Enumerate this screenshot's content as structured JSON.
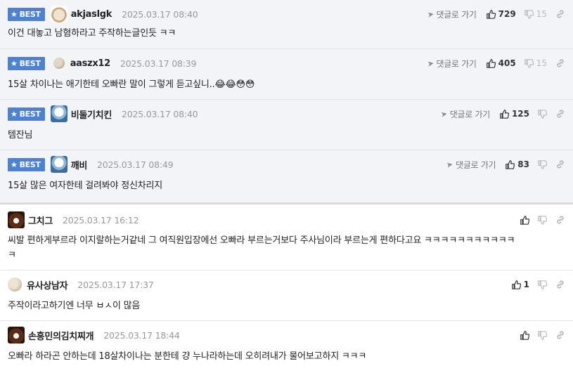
{
  "labels": {
    "best": "BEST",
    "reply": "댓글로 가기"
  },
  "colors": {
    "best_badge": "#4b82d6",
    "best_row_bg": "#f2f4f7"
  },
  "comments": [
    {
      "best": true,
      "avatar": "dog-avatar",
      "nick": "akjaslgk",
      "date": "2025.03.17 08:40",
      "text": "이건 대놓고 남혐하라고 주작하는글인듯 ㅋㅋ",
      "up": "729",
      "down": "15",
      "has_reply": true
    },
    {
      "best": true,
      "avatar": "ball-avatar",
      "nick": "aaszx12",
      "date": "2025.03.17 08:39",
      "text": "15살 차이나는 애기한테 오빠란 말이 그렇게 듣고싶니..😂😂😳😳",
      "up": "405",
      "down": "15",
      "has_reply": true
    },
    {
      "best": true,
      "avatar": "bird-avatar",
      "nick": "비둘기치킨",
      "date": "2025.03.17 08:40",
      "text": "템잔님",
      "up": "125",
      "down": "",
      "has_reply": true
    },
    {
      "best": true,
      "avatar": "bird-avatar",
      "nick": "깨비",
      "date": "2025.03.17 08:49",
      "text": "15살 많은 여자한테 걸려봐야 정신차리지",
      "up": "83",
      "down": "",
      "has_reply": true
    },
    {
      "best": false,
      "avatar": "bear-avatar",
      "nick": "그치그",
      "date": "2025.03.17 16:12",
      "text": "씨발 편하게부르라 이지랄하는거같네 그 여직원입장에선 오빠라 부르는거보다 주사님이라 부르는게 편하다고요 ㅋㅋㅋㅋㅋㅋㅋㅋㅋㅋㅋ",
      "text2": "ㅋ",
      "up": "",
      "down": "",
      "has_reply": false
    },
    {
      "best": false,
      "avatar": "ball-avatar",
      "nick": "유사상남자",
      "date": "2025.03.17 17:37",
      "text": "주작이라고하기엔 너무 ㅂㅅ이 많음",
      "up": "1",
      "down": "",
      "has_reply": false
    },
    {
      "best": false,
      "avatar": "bear-avatar",
      "nick": "손흥민의김치찌개",
      "date": "2025.03.17 18:44",
      "text": "오빠라 하라곤 안하는데 18살차이나는 분한테 걍 누나라하는데 오히려내가 물어보고하지 ㅋㅋㅋ",
      "up": "",
      "down": "",
      "has_reply": false
    }
  ]
}
